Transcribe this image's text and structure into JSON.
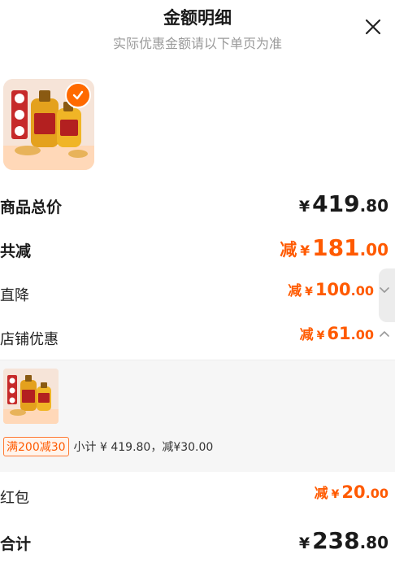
{
  "header": {
    "title": "金额明细",
    "subtitle": "实际优惠金额请以下单页为准"
  },
  "summary": {
    "goods_total": {
      "label": "商品总价",
      "yen": "¥",
      "integer": "419",
      "decimal": ".80"
    },
    "total_discount": {
      "label": "共减",
      "prefix": "减",
      "yen": "¥",
      "integer": "181",
      "decimal": ".00"
    },
    "direct_discount": {
      "label": "直降",
      "prefix": "减",
      "yen": "¥",
      "integer": "100",
      "decimal": ".00"
    },
    "shop_discount": {
      "label": "店铺优惠",
      "prefix": "减",
      "yen": "¥",
      "integer": "61",
      "decimal": ".00"
    },
    "red_packet": {
      "label": "红包",
      "prefix": "减",
      "yen": "¥",
      "integer": "20",
      "decimal": ".00"
    },
    "grand_total": {
      "label": "合计",
      "yen": "¥",
      "integer": "238",
      "decimal": ".80"
    }
  },
  "shop_panel": {
    "promo_tag": "满200减30",
    "subtotal_text": "小计 ¥ 419.80，减¥30.00"
  },
  "colors": {
    "accent": "#ff5a00",
    "text": "#1a1a1a",
    "muted": "#9a9a9a",
    "panel": "#f6f6f6"
  },
  "icons": {
    "close": "close-icon",
    "check": "check-icon",
    "expand": "chevron-down-icon",
    "collapse": "chevron-up-icon"
  }
}
